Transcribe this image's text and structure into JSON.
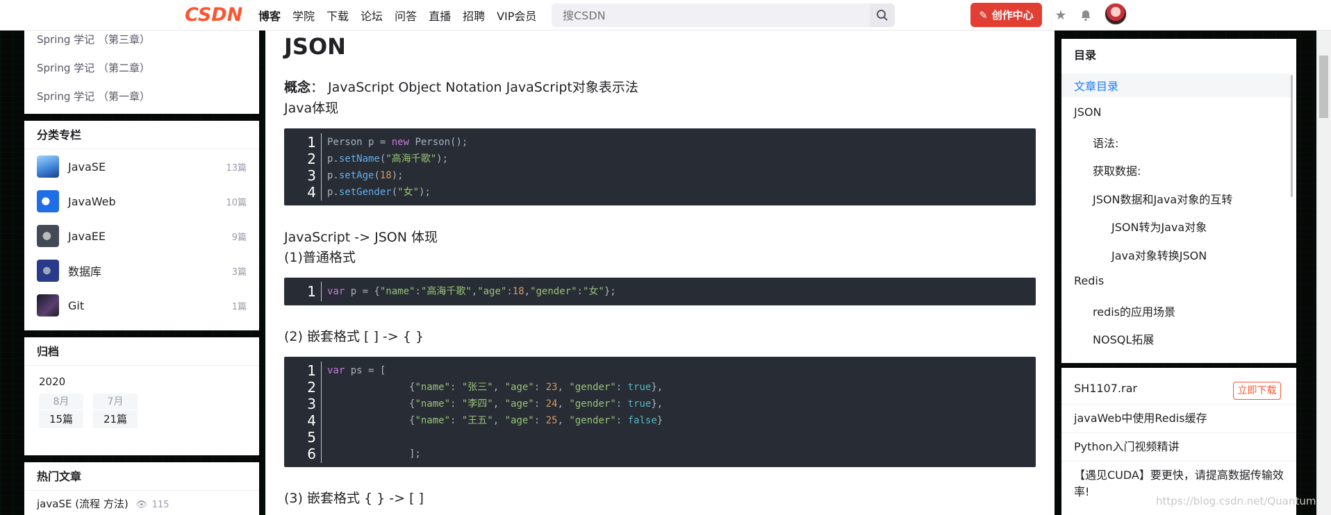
{
  "header": {
    "logo": "CSDN",
    "nav": [
      "博客",
      "学院",
      "下载",
      "论坛",
      "问答",
      "直播",
      "招聘",
      "VIP会员"
    ],
    "search_placeholder": "搜CSDN",
    "create_label": "创作中心"
  },
  "sidebar": {
    "recent": [
      "Spring 学记 （第三章）",
      "Spring 学记 （第二章）",
      "Spring 学记 （第一章）"
    ],
    "categories_title": "分类专栏",
    "categories": [
      {
        "name": "JavaSE",
        "count": "13篇",
        "color": "#3b7fd6"
      },
      {
        "name": "JavaWeb",
        "count": "10篇",
        "color": "#1e6ee8"
      },
      {
        "name": "JavaEE",
        "count": "9篇",
        "color": "#444a55"
      },
      {
        "name": "数据库",
        "count": "3篇",
        "color": "#2a3a8a"
      },
      {
        "name": "Git",
        "count": "1篇",
        "color": "#3a3050"
      }
    ],
    "archive_title": "归档",
    "archive_year": "2020",
    "archive_months": [
      {
        "month": "8月",
        "count": "15篇"
      },
      {
        "month": "7月",
        "count": "21篇"
      }
    ],
    "hot_title": "热门文章",
    "hot_items": [
      {
        "title": "javaSE (流程 方法)",
        "views": "115"
      }
    ]
  },
  "main": {
    "heading": "JSON",
    "concept_label": "概念",
    "concept_text": "：  JavaScript Object Notation JavaScript对象表示法",
    "java_label": "Java体现",
    "code1": [
      {
        "num": "1",
        "text": "Person p = new Person();"
      },
      {
        "num": "2",
        "text": "p.setName(\"高海千歌\");"
      },
      {
        "num": "3",
        "text": "p.setAge(18);"
      },
      {
        "num": "4",
        "text": "p.setGender(\"女\");"
      }
    ],
    "js_label": "JavaScript -> JSON 体现",
    "format1_label": "(1)普通格式",
    "code2": [
      {
        "num": "1",
        "text": "var p = {\"name\":\"高海千歌\",\"age\":18,\"gender\":\"女\"};"
      }
    ],
    "format2_label": "(2) 嵌套格式 [ ] -> { }",
    "code3": [
      {
        "num": "1",
        "text": "var ps = ["
      },
      {
        "num": "2",
        "text": "\t\t\t{\"name\": \"张三\", \"age\": 23, \"gender\": true},"
      },
      {
        "num": "3",
        "text": "\t\t\t{\"name\": \"李四\", \"age\": 24, \"gender\": true},"
      },
      {
        "num": "4",
        "text": "\t\t\t{\"name\": \"王五\", \"age\": 25, \"gender\": false}"
      },
      {
        "num": "5",
        "text": ""
      },
      {
        "num": "6",
        "text": "\t\t\t];"
      }
    ],
    "format3_label": "(3) 嵌套格式 { } -> [ ]"
  },
  "toc": {
    "title": "目录",
    "items": [
      {
        "label": "文章目录",
        "level": 1,
        "active": true
      },
      {
        "label": "JSON",
        "level": 1
      },
      {
        "label": "语法:",
        "level": 2
      },
      {
        "label": "获取数据:",
        "level": 2
      },
      {
        "label": "JSON数据和Java对象的互转",
        "level": 2
      },
      {
        "label": "JSON转为Java对象",
        "level": 3
      },
      {
        "label": "Java对象转换JSON",
        "level": 3
      },
      {
        "label": "Redis",
        "level": 1
      },
      {
        "label": "redis的应用场景",
        "level": 2
      },
      {
        "label": "NOSQL拓展",
        "level": 2
      }
    ]
  },
  "recommend": {
    "items": [
      "SH1107.rar",
      "javaWeb中使用Redis缓存",
      "Python入门视频精讲",
      "【遇见CUDA】要更快，请提高数据传输效率!"
    ],
    "download_label": "立即下载"
  },
  "watermark": "https://blog.csdn.net/QuantumYou"
}
